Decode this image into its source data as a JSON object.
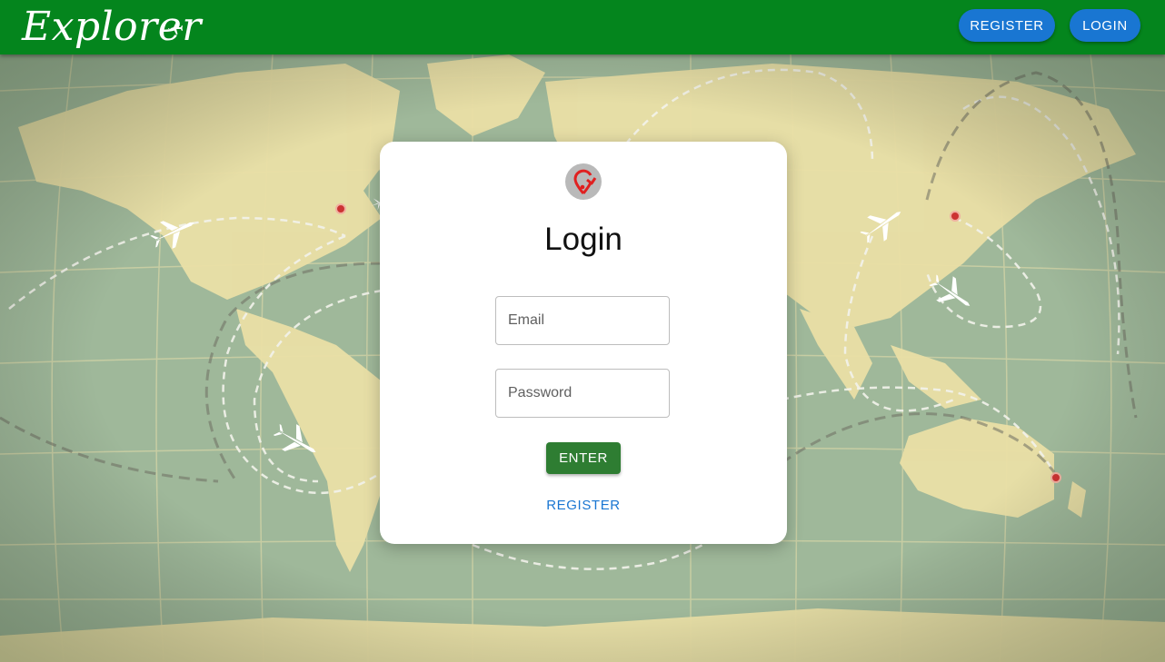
{
  "header": {
    "logo_text": "Explorer",
    "logo_icon": "airplane-icon",
    "register_label": "REGISTER",
    "login_label": "LOGIN",
    "brand_color": "#04851d",
    "button_color": "#1976d2"
  },
  "card": {
    "icon": "location-refresh-icon",
    "title": "Login",
    "email_placeholder": "Email",
    "password_placeholder": "Password",
    "enter_label": "ENTER",
    "register_link": "REGISTER",
    "enter_color": "#2e7d32",
    "icon_color": "#e02020"
  },
  "background": {
    "description_icon": "world-map-background",
    "ocean_color": "#9fb89a",
    "land_color": "#eadfa6"
  }
}
